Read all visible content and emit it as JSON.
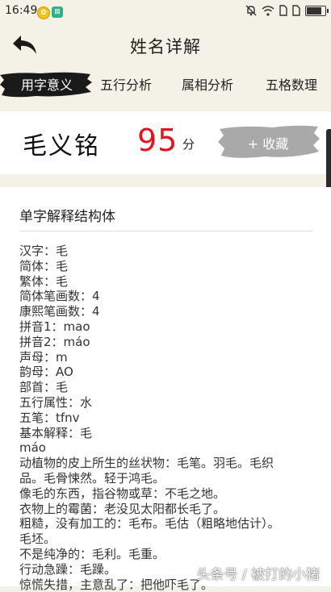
{
  "status_bar": {
    "time": "16:49",
    "icons": [
      "alarm-off-icon",
      "wifi-icon",
      "sim1-icon",
      "sim2-icon",
      "battery-icon"
    ],
    "battery_level": 0.85
  },
  "header": {
    "title": "姓名详解",
    "back_icon": "back-arrow-icon"
  },
  "tabs": [
    {
      "label": "用字意义",
      "active": true
    },
    {
      "label": "五行分析",
      "active": false
    },
    {
      "label": "属相分析",
      "active": false
    },
    {
      "label": "五格数理",
      "active": false
    }
  ],
  "name_card": {
    "name": "毛义铭",
    "score": "95",
    "score_unit": "分",
    "favorite_label": "+ 收藏"
  },
  "detail": {
    "section_title": "单字解释结构体",
    "lines": [
      "汉字：毛",
      "简体：毛",
      "繁体：毛",
      "简体笔画数：4",
      "康熙笔画数：4",
      "拼音1：mao",
      "拼音2：máo",
      "声母：m",
      "韵母：AO",
      "部首：毛",
      "五行属性：水",
      "五笔：tfnv",
      "基本解释：毛",
      "máo",
      "动植物的皮上所生的丝状物：毛笔。羽毛。毛织",
      "品。毛骨悚然。轻于鸿毛。",
      "像毛的东西，指谷物或草：不毛之地。",
      "衣物上的霉菌：老没见太阳都长毛了。",
      "粗糙，没有加工的：毛布。毛估（粗略地估计）。",
      "毛坯。",
      "不是纯净的：毛利。毛重。",
      "行动急躁：毛躁。",
      "惊慌失措，主意乱了：把他吓毛了。"
    ]
  },
  "watermark": "头条号 / 被打的小猪",
  "colors": {
    "background": "#f4f2e6",
    "score": "#e3141c",
    "brush_dark": "#1a1a1a",
    "brush_gray": "#a9a9a9"
  }
}
